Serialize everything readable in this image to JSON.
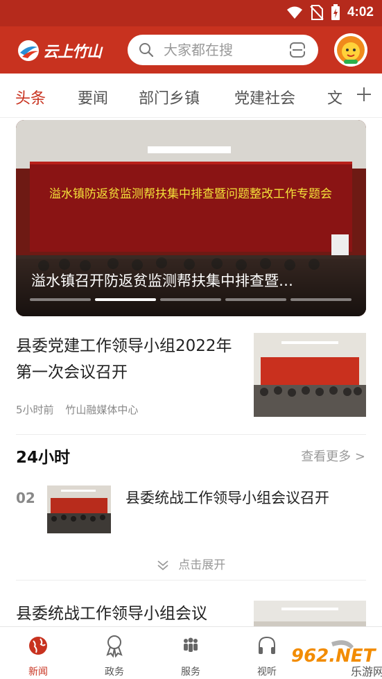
{
  "status_bar": {
    "time": "4:02"
  },
  "header": {
    "logo_text": "云上竹山",
    "search": {
      "placeholder": "大家都在搜"
    }
  },
  "tabs": [
    {
      "label": "头条",
      "active": true
    },
    {
      "label": "要闻"
    },
    {
      "label": "部门乡镇"
    },
    {
      "label": "党建社会"
    },
    {
      "label": "文"
    }
  ],
  "banner": {
    "slide_text": "溢水镇防返贫监测帮扶集中排查暨问题整改工作专题会",
    "caption": "溢水镇召开防返贫监测帮扶集中排查暨…",
    "slide_index": 2,
    "slide_count": 5
  },
  "news": [
    {
      "title": "县委党建工作领导小组2022年第一次会议召开",
      "time": "5小时前",
      "source": "竹山融媒体中心"
    },
    {
      "title": "县委统战工作领导小组会议"
    }
  ],
  "hot24": {
    "title": "24小时",
    "see_more": "查看更多 >",
    "items": [
      {
        "rank": "02",
        "title": "县委统战工作领导小组会议召开"
      }
    ],
    "expand_label": "点击展开"
  },
  "bottom_nav": [
    {
      "label": "新闻",
      "icon": "globe-icon",
      "active": true
    },
    {
      "label": "政务",
      "icon": "award-icon"
    },
    {
      "label": "服务",
      "icon": "people-icon"
    },
    {
      "label": "视听",
      "icon": "headphones-icon"
    }
  ],
  "watermark": {
    "text": "962.NET",
    "subtext": "乐游网"
  },
  "colors": {
    "brand": "#c8321f",
    "status_bar": "#b52a1c"
  }
}
